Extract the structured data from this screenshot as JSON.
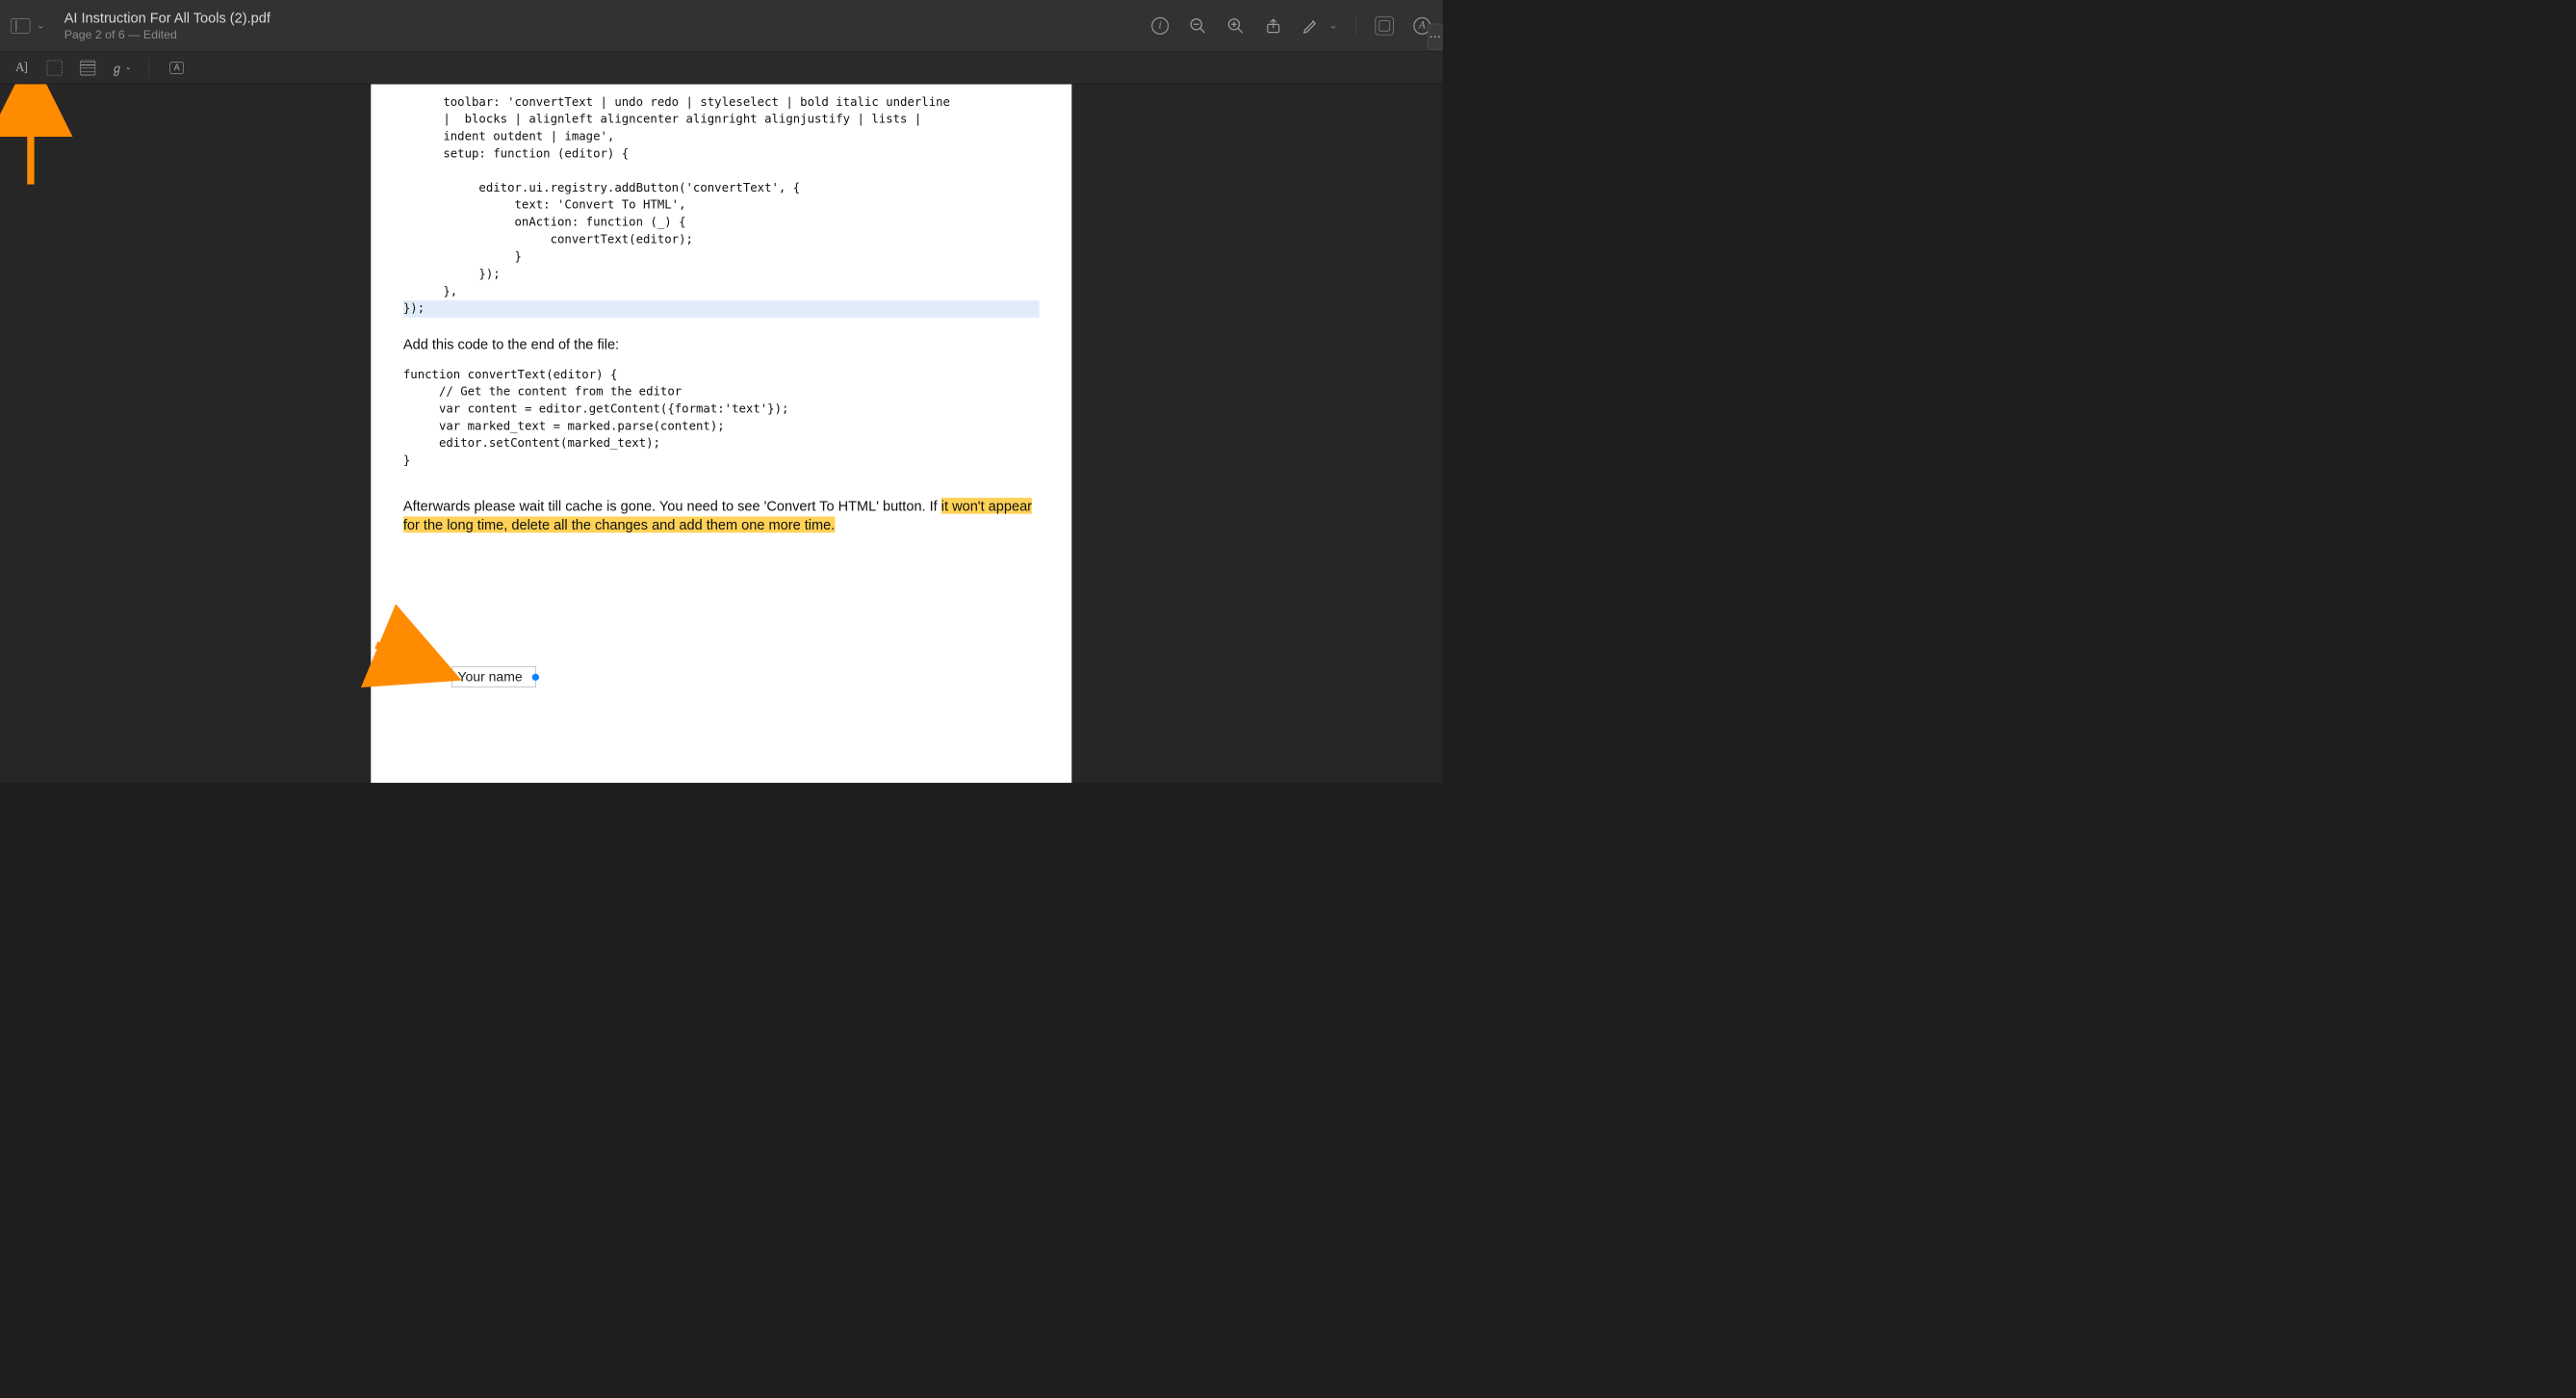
{
  "header": {
    "title": "AI Instruction For All Tools (2).pdf",
    "subtitle": "Page 2 of 6 — Edited"
  },
  "toolbar_icons": {
    "info": "i",
    "markup_letter": "A"
  },
  "markup": {
    "text_tool": "A]",
    "text_style_label": "A"
  },
  "document": {
    "code1_lines": [
      "toolbar: 'convertText | undo redo | styleselect | bold italic underline",
      "|  blocks | alignleft aligncenter alignright alignjustify | lists |",
      "indent outdent | image',",
      "setup: function (editor) {",
      "",
      "     editor.ui.registry.addButton('convertText', {",
      "          text: 'Convert To HTML',",
      "          onAction: function (_) {",
      "               convertText(editor);",
      "          }",
      "     });",
      "},"
    ],
    "code1_tail": "});",
    "para1": "Add this code to the end of the file:",
    "code2_lines": [
      "function convertText(editor) {",
      "     // Get the content from the editor",
      "     var content = editor.getContent({format:'text'});",
      "     var marked_text = marked.parse(content);",
      "     editor.setContent(marked_text);",
      "}"
    ],
    "para2_pre": "Afterwards please wait till cache is gone. You need to see  'Convert To HTML' button. If ",
    "para2_hl": "it won't appear for the long time, delete all the changes and add them one more time.",
    "annotation_text": "Your name"
  }
}
